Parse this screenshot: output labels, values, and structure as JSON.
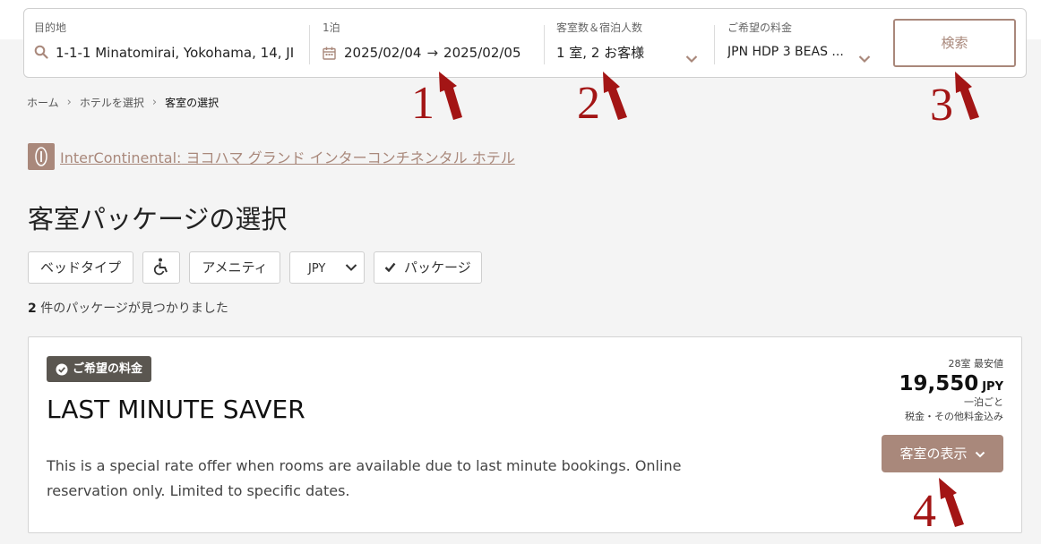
{
  "search": {
    "destination": {
      "label": "目的地",
      "value": "1-1-1 Minatomirai, Yokohama, 14, JI"
    },
    "dates": {
      "label": "1泊",
      "check_in": "2025/02/04",
      "check_out": "2025/02/05",
      "arrow": "→"
    },
    "guests": {
      "label": "客室数＆宿泊人数",
      "value": "1 室, 2 お客様"
    },
    "rate": {
      "label": "ご希望の料金",
      "value": "JPN HDP 3 BEAS ..."
    },
    "search_button": "検索"
  },
  "breadcrumb": {
    "home": "ホーム",
    "hotels": "ホテルを選択",
    "current": "客室の選択"
  },
  "hotel": {
    "brand": "InterContinental:",
    "name": " ヨコハマ グランド インターコンチネンタル ホテル"
  },
  "page_title": "客室パッケージの選択",
  "filters": {
    "bed_type": "ベッドタイプ",
    "amenities": "アメニティ",
    "currency": "JPY",
    "package": "パッケージ"
  },
  "results": {
    "count": "2",
    "text": " 件のパッケージが見つかりました"
  },
  "package": {
    "badge": "ご希望の料金",
    "title": "LAST MINUTE SAVER",
    "description": "This is a special rate offer when rooms are available due to last minute bookings. Online reservation only. Limited to specific dates.",
    "price_note": "28室 最安値",
    "price": "19,550",
    "currency": "JPY",
    "per_night": "一泊ごと",
    "tax_note": "税金・その他料金込み",
    "rooms_button": "客室の表示"
  },
  "annotations": [
    "1",
    "2",
    "3",
    "4"
  ],
  "colors": {
    "accent": "#a9887b",
    "badge": "#5a5650",
    "annotation": "#a31515",
    "background": "#f4f4f4"
  }
}
